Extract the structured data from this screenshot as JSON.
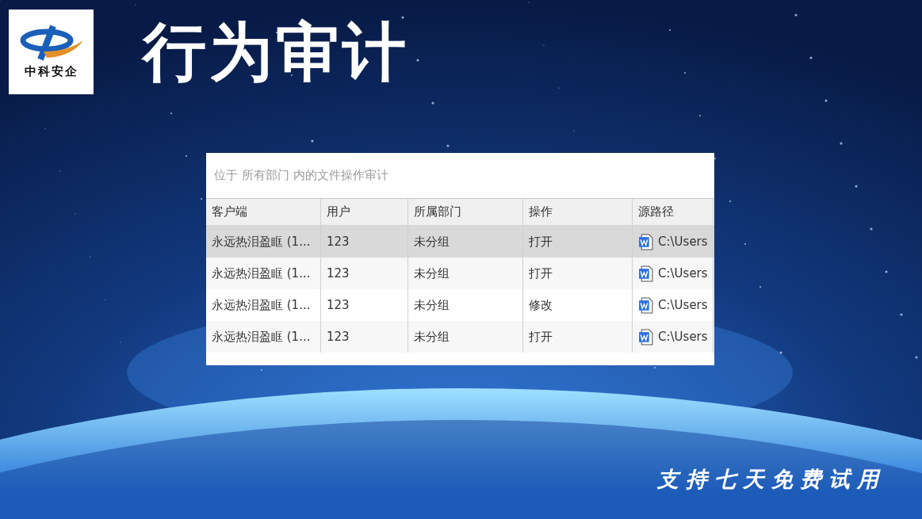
{
  "logo": {
    "name": "中科安企"
  },
  "title": "行为审计",
  "panel": {
    "caption": "位于 所有部门 内的文件操作审计",
    "table": {
      "columns": [
        "客户端",
        "用户",
        "所属部门",
        "操作",
        "源路径"
      ],
      "rows": [
        {
          "selected": true,
          "cells": [
            "永远热泪盈眶 (1...",
            "123",
            "未分组",
            "打开",
            "C:\\Users"
          ]
        },
        {
          "selected": false,
          "cells": [
            "永远热泪盈眶 (1...",
            "123",
            "未分组",
            "打开",
            "C:\\Users"
          ]
        },
        {
          "selected": false,
          "cells": [
            "永远热泪盈眶 (1...",
            "123",
            "未分组",
            "修改",
            "C:\\Users"
          ]
        },
        {
          "selected": false,
          "cells": [
            "永远热泪盈眶 (1...",
            "123",
            "未分组",
            "打开",
            "C:\\Users"
          ]
        }
      ]
    }
  },
  "slogan": "支持七天免费试用"
}
